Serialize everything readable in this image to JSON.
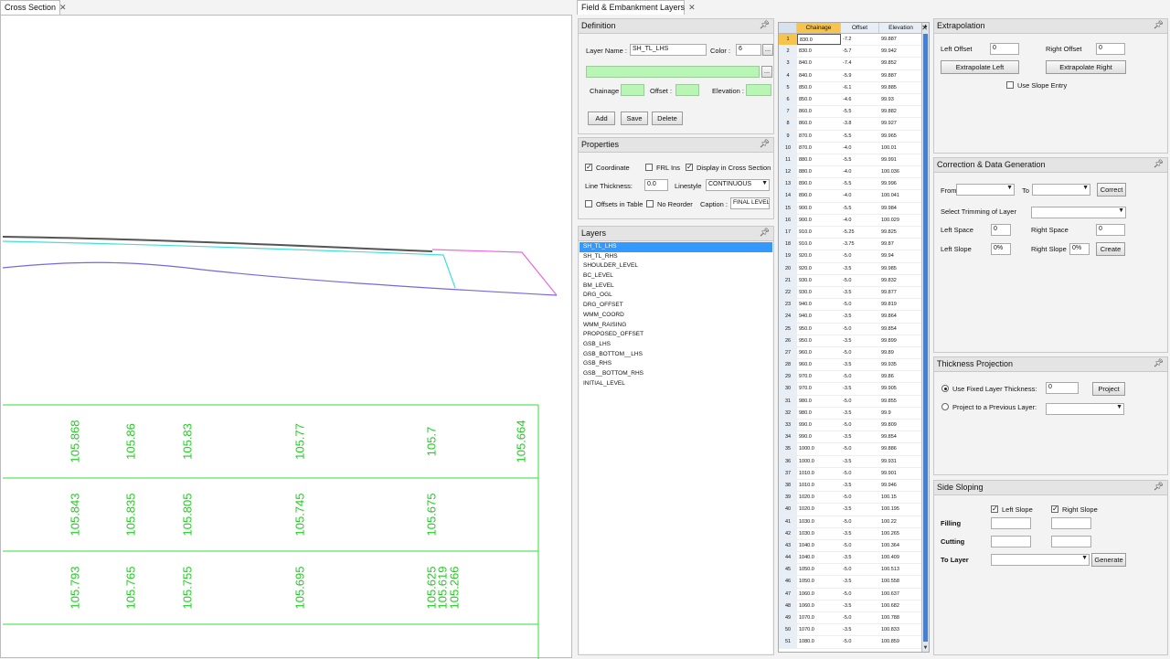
{
  "tabs": {
    "cross_section": "Cross Section",
    "field_embankment": "Field & Embankment Layers",
    "close": "✕"
  },
  "definition": {
    "title": "Definition",
    "layer_name_label": "Layer Name :",
    "layer_name_value": "SH_TL_LHS",
    "color_label": "Color :",
    "color_value": "6",
    "browse": "...",
    "chainage_label": "Chainage :",
    "offset_label": "Offset :",
    "elevation_label": "Elevation :",
    "add": "Add",
    "save": "Save",
    "delete": "Delete"
  },
  "properties": {
    "title": "Properties",
    "coordinate": "Coordinate",
    "frl_ins": "FRL Ins",
    "display_in_cs": "Display in Cross Section",
    "line_thickness_label": "Line Thickness:",
    "line_thickness_value": "0.0",
    "linestyle_label": "Linestyle",
    "linestyle_value": "CONTINUOUS",
    "offsets_in_table": "Offsets in Table",
    "no_reorder": "No Reorder",
    "caption_label": "Caption :",
    "caption_value": "FINAL LEVEL"
  },
  "layers": {
    "title": "Layers",
    "items": [
      "SH_TL_LHS",
      "SH_TL_RHS",
      "SHOULDER_LEVEL",
      "BC_LEVEL",
      "BM_LEVEL",
      "DRG_OGL",
      "DRG_OFFSET",
      "WMM_COORD",
      "WMM_RAISING",
      "PROPOSED_OFFSET",
      "GSB_LHS",
      "GSB_BOTTOM__LHS",
      "GSB_RHS",
      "GSB__BOTTOM_RHS",
      "INITIAL_LEVEL"
    ]
  },
  "grid": {
    "headers": [
      "Chainage",
      "Offset",
      "Elevation"
    ],
    "rows": [
      [
        "1",
        "830.0",
        "-7.2",
        "99.887"
      ],
      [
        "2",
        "830.0",
        "-5.7",
        "99.942"
      ],
      [
        "3",
        "840.0",
        "-7.4",
        "99.852"
      ],
      [
        "4",
        "840.0",
        "-5.9",
        "99.887"
      ],
      [
        "5",
        "850.0",
        "-6.1",
        "99.885"
      ],
      [
        "6",
        "850.0",
        "-4.6",
        "99.93"
      ],
      [
        "7",
        "860.0",
        "-5.5",
        "99.882"
      ],
      [
        "8",
        "860.0",
        "-3.8",
        "99.927"
      ],
      [
        "9",
        "870.0",
        "-5.5",
        "99.965"
      ],
      [
        "10",
        "870.0",
        "-4.0",
        "100.01"
      ],
      [
        "11",
        "880.0",
        "-5.5",
        "99.991"
      ],
      [
        "12",
        "880.0",
        "-4.0",
        "100.036"
      ],
      [
        "13",
        "890.0",
        "-5.5",
        "99.996"
      ],
      [
        "14",
        "890.0",
        "-4.0",
        "100.041"
      ],
      [
        "15",
        "900.0",
        "-5.5",
        "99.984"
      ],
      [
        "16",
        "900.0",
        "-4.0",
        "100.029"
      ],
      [
        "17",
        "910.0",
        "-5.25",
        "99.825"
      ],
      [
        "18",
        "910.0",
        "-3.75",
        "99.87"
      ],
      [
        "19",
        "920.0",
        "-5.0",
        "99.94"
      ],
      [
        "20",
        "920.0",
        "-3.5",
        "99.985"
      ],
      [
        "21",
        "930.0",
        "-5.0",
        "99.832"
      ],
      [
        "22",
        "930.0",
        "-3.5",
        "99.877"
      ],
      [
        "23",
        "940.0",
        "-5.0",
        "99.819"
      ],
      [
        "24",
        "940.0",
        "-3.5",
        "99.864"
      ],
      [
        "25",
        "950.0",
        "-5.0",
        "99.854"
      ],
      [
        "26",
        "950.0",
        "-3.5",
        "99.899"
      ],
      [
        "27",
        "960.0",
        "-5.0",
        "99.89"
      ],
      [
        "28",
        "960.0",
        "-3.5",
        "99.935"
      ],
      [
        "29",
        "970.0",
        "-5.0",
        "99.86"
      ],
      [
        "30",
        "970.0",
        "-3.5",
        "99.905"
      ],
      [
        "31",
        "980.0",
        "-5.0",
        "99.855"
      ],
      [
        "32",
        "980.0",
        "-3.5",
        "99.9"
      ],
      [
        "33",
        "990.0",
        "-5.0",
        "99.809"
      ],
      [
        "34",
        "990.0",
        "-3.5",
        "99.854"
      ],
      [
        "35",
        "1000.0",
        "-5.0",
        "99.886"
      ],
      [
        "36",
        "1000.0",
        "-3.5",
        "99.931"
      ],
      [
        "37",
        "1010.0",
        "-5.0",
        "99.901"
      ],
      [
        "38",
        "1010.0",
        "-3.5",
        "99.946"
      ],
      [
        "39",
        "1020.0",
        "-5.0",
        "100.15"
      ],
      [
        "40",
        "1020.0",
        "-3.5",
        "100.195"
      ],
      [
        "41",
        "1030.0",
        "-5.0",
        "100.22"
      ],
      [
        "42",
        "1030.0",
        "-3.5",
        "100.265"
      ],
      [
        "43",
        "1040.0",
        "-5.0",
        "100.364"
      ],
      [
        "44",
        "1040.0",
        "-3.5",
        "100.409"
      ],
      [
        "45",
        "1050.0",
        "-5.0",
        "100.513"
      ],
      [
        "46",
        "1050.0",
        "-3.5",
        "100.558"
      ],
      [
        "47",
        "1060.0",
        "-5.0",
        "100.637"
      ],
      [
        "48",
        "1060.0",
        "-3.5",
        "100.682"
      ],
      [
        "49",
        "1070.0",
        "-5.0",
        "100.788"
      ],
      [
        "50",
        "1070.0",
        "-3.5",
        "100.833"
      ],
      [
        "51",
        "1080.0",
        "-5.0",
        "100.859"
      ]
    ]
  },
  "extrapolation": {
    "title": "Extrapolation",
    "left_offset_label": "Left Offset",
    "left_offset_value": "0",
    "right_offset_label": "Right Offset",
    "right_offset_value": "0",
    "extrapolate_left": "Extrapolate Left",
    "extrapolate_right": "Extrapolate Right",
    "use_slope_entry": "Use Slope Entry"
  },
  "correction": {
    "title": "Correction & Data Generation",
    "from_label": "From",
    "to_label": "To",
    "correct": "Correct",
    "select_trimming": "Select Trimming of Layer",
    "left_space_label": "Left Space",
    "left_space_value": "0",
    "right_space_label": "Right Space",
    "right_space_value": "0",
    "left_slope_label": "Left Slope",
    "left_slope_value": "0%",
    "right_slope_label": "Right Slope",
    "right_slope_value": "0%",
    "create": "Create"
  },
  "thickness": {
    "title": "Thickness Projection",
    "use_fixed": "Use Fixed Layer Thickness:",
    "fixed_value": "0",
    "project": "Project",
    "project_prev": "Project to a Previous Layer:"
  },
  "side_sloping": {
    "title": "Side Sloping",
    "left_slope": "Left Slope",
    "right_slope": "Right Slope",
    "filling": "Filling",
    "cutting": "Cutting",
    "to_layer": "To Layer",
    "generate": "Generate"
  },
  "cross_section": {
    "row1": [
      "105.868",
      "105.86",
      "105.83",
      "105.77",
      "105.7",
      "105.664"
    ],
    "row2": [
      "105.843",
      "105.835",
      "105.805",
      "105.745",
      "105.675"
    ],
    "row3": [
      "105.793",
      "105.765",
      "105.755",
      "105.695",
      "105.625",
      "105.619",
      "105.266"
    ],
    "colors": {
      "grid": "#33dd33",
      "text": "#22cc22",
      "layer_dark": "#555555",
      "layer_cyan": "#44dddd",
      "layer_pink": "#ee66dd",
      "layer_purple": "#7a66dd"
    }
  }
}
